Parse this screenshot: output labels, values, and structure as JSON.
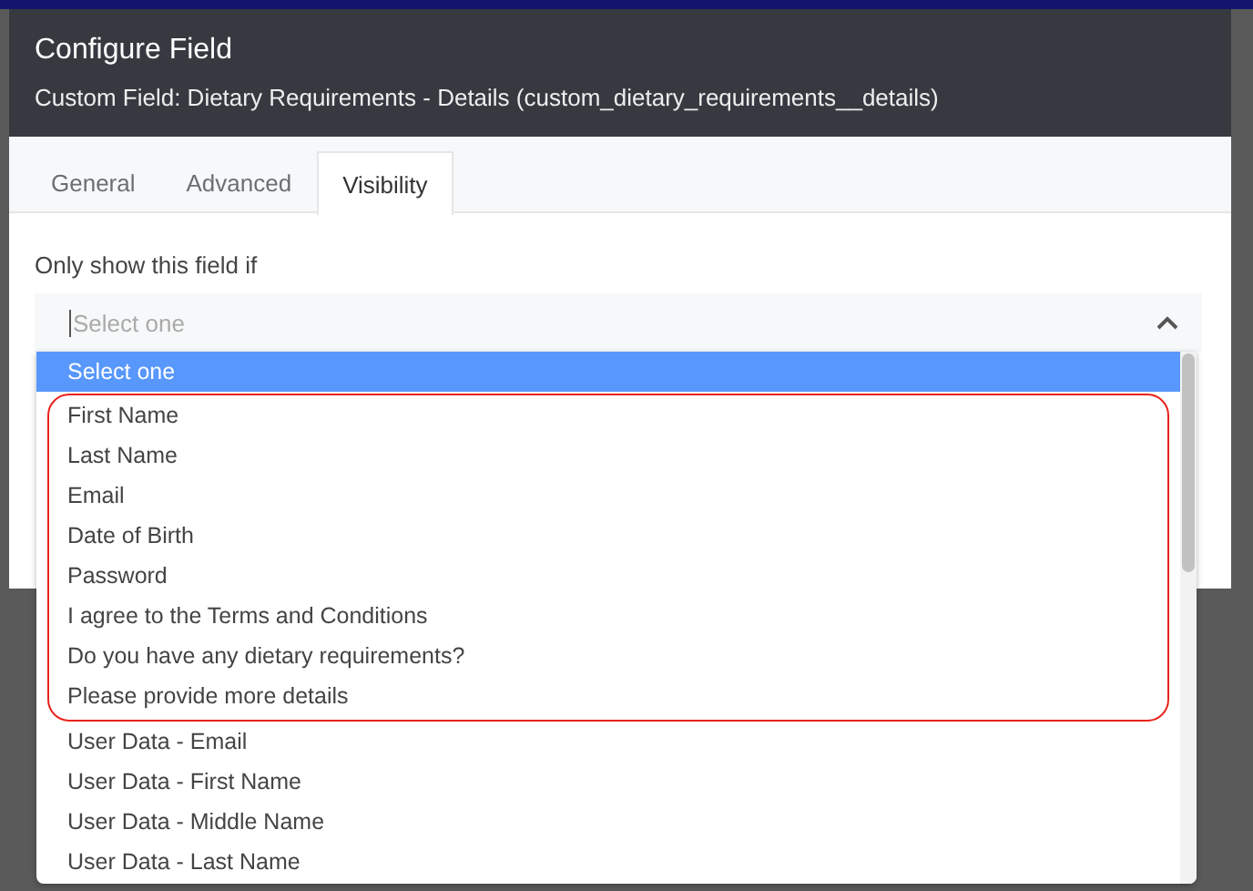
{
  "dialog": {
    "title": "Configure Field",
    "subtitle": "Custom Field: Dietary Requirements - Details (custom_dietary_requirements__details)"
  },
  "tabs": [
    {
      "label": "General",
      "selected": false
    },
    {
      "label": "Advanced",
      "selected": false
    },
    {
      "label": "Visibility",
      "selected": true
    }
  ],
  "condition": {
    "label": "Only show this field if",
    "placeholder": "Select one",
    "expanded": true
  },
  "options": [
    {
      "label": "Select one",
      "selected": true,
      "highlighted": false
    },
    {
      "label": "First Name",
      "selected": false,
      "highlighted": true
    },
    {
      "label": "Last Name",
      "selected": false,
      "highlighted": true
    },
    {
      "label": "Email",
      "selected": false,
      "highlighted": true
    },
    {
      "label": "Date of Birth",
      "selected": false,
      "highlighted": true
    },
    {
      "label": "Password",
      "selected": false,
      "highlighted": true
    },
    {
      "label": "I agree to the Terms and Conditions",
      "selected": false,
      "highlighted": true
    },
    {
      "label": "Do you have any dietary requirements?",
      "selected": false,
      "highlighted": true
    },
    {
      "label": "Please provide more details",
      "selected": false,
      "highlighted": true
    },
    {
      "label": "User Data - Email",
      "selected": false,
      "highlighted": false
    },
    {
      "label": "User Data - First Name",
      "selected": false,
      "highlighted": false
    },
    {
      "label": "User Data - Middle Name",
      "selected": false,
      "highlighted": false
    },
    {
      "label": "User Data - Last Name",
      "selected": false,
      "highlighted": false
    }
  ]
}
